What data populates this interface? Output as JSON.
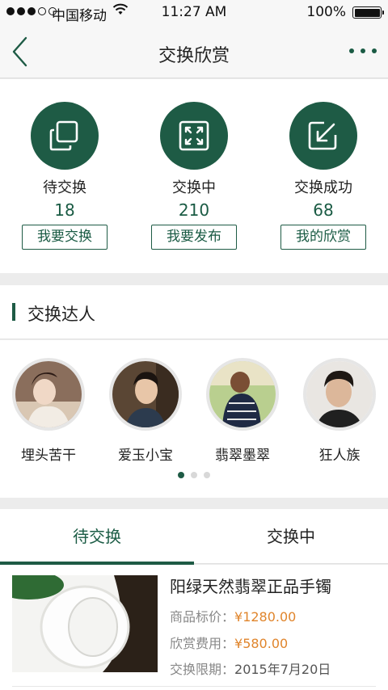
{
  "status_bar": {
    "carrier": "中国移动",
    "time": "11:27 AM",
    "battery": "100%",
    "battery_level": 1.0
  },
  "nav": {
    "title": "交换欣赏"
  },
  "stats": [
    {
      "label": "待交换",
      "count": "18",
      "button": "我要交换",
      "icon": "copy-icon"
    },
    {
      "label": "交换中",
      "count": "210",
      "button": "我要发布",
      "icon": "expand-icon"
    },
    {
      "label": "交换成功",
      "count": "68",
      "button": "我的欣赏",
      "icon": "arrow-down-left-icon"
    }
  ],
  "experts": {
    "title": "交换达人",
    "people": [
      {
        "name": "埋头苦干"
      },
      {
        "name": "爱玉小宝"
      },
      {
        "name": "翡翠墨翠"
      },
      {
        "name": "狂人族"
      }
    ],
    "page_count": 3,
    "current_page": 1
  },
  "tabs": [
    {
      "label": "待交换",
      "active": true
    },
    {
      "label": "交换中",
      "active": false
    }
  ],
  "item": {
    "title": "阳绿天然翡翠正品手镯",
    "price_label": "商品标价：",
    "price_value": "¥1280.00",
    "fee_label": "欣赏费用：",
    "fee_value": "¥580.00",
    "deadline_label": "交换限期：",
    "deadline_value": "2015年7月20日"
  },
  "colors": {
    "accent": "#1e5b45",
    "price": "#e0852c"
  }
}
